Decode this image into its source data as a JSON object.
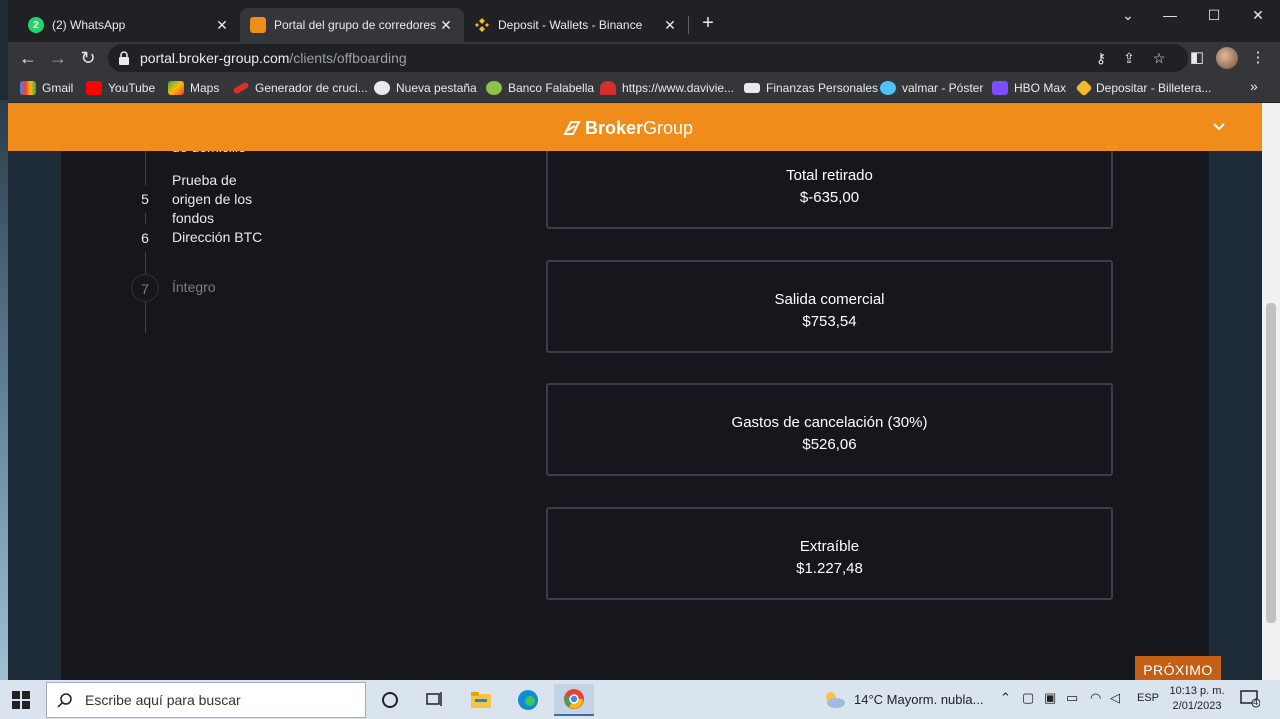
{
  "browser": {
    "tabs": [
      {
        "label": "(2) WhatsApp",
        "badge": "2",
        "color": "#25d366"
      },
      {
        "label": "Portal del grupo de corredores",
        "color": "#f08c19"
      },
      {
        "label": "Deposit - Wallets - Binance",
        "color": "#f3ba2f"
      }
    ],
    "url_host": "portal.broker-group.com",
    "url_path": "/clients/offboarding",
    "bookmarks": [
      "Gmail",
      "YouTube",
      "Maps",
      "Generador de cruci...",
      "Nueva pestaña",
      "Banco Falabella",
      "https://www.davivie...",
      "Finanzas Personales",
      "valmar - Póster",
      "HBO Max",
      "Depositar - Billetera..."
    ]
  },
  "header": {
    "logo_bold": "Broker",
    "logo_light": "Group",
    "accent": "#f08c19"
  },
  "stepper": {
    "partial_label": "de domicilio",
    "steps": [
      {
        "num": "5",
        "label": "Prueba de origen de los fondos"
      },
      {
        "num": "6",
        "label": "Dirección BTC"
      },
      {
        "num": "7",
        "label": "Íntegro"
      }
    ]
  },
  "cards": [
    {
      "title": "Total retirado",
      "value": "$-635,00"
    },
    {
      "title": "Salida comercial",
      "value": "$753,54"
    },
    {
      "title": "Gastos de cancelación (30%)",
      "value": "$526,06"
    },
    {
      "title": "Extraíble",
      "value": "$1.227,48"
    }
  ],
  "next_button": "PRÓXIMO",
  "taskbar": {
    "search_placeholder": "Escribe aquí para buscar",
    "weather": "14°C  Mayorm. nubla...",
    "lang": "ESP",
    "time": "10:13 p. m.",
    "date": "2/01/2023",
    "notif_count": "4"
  }
}
